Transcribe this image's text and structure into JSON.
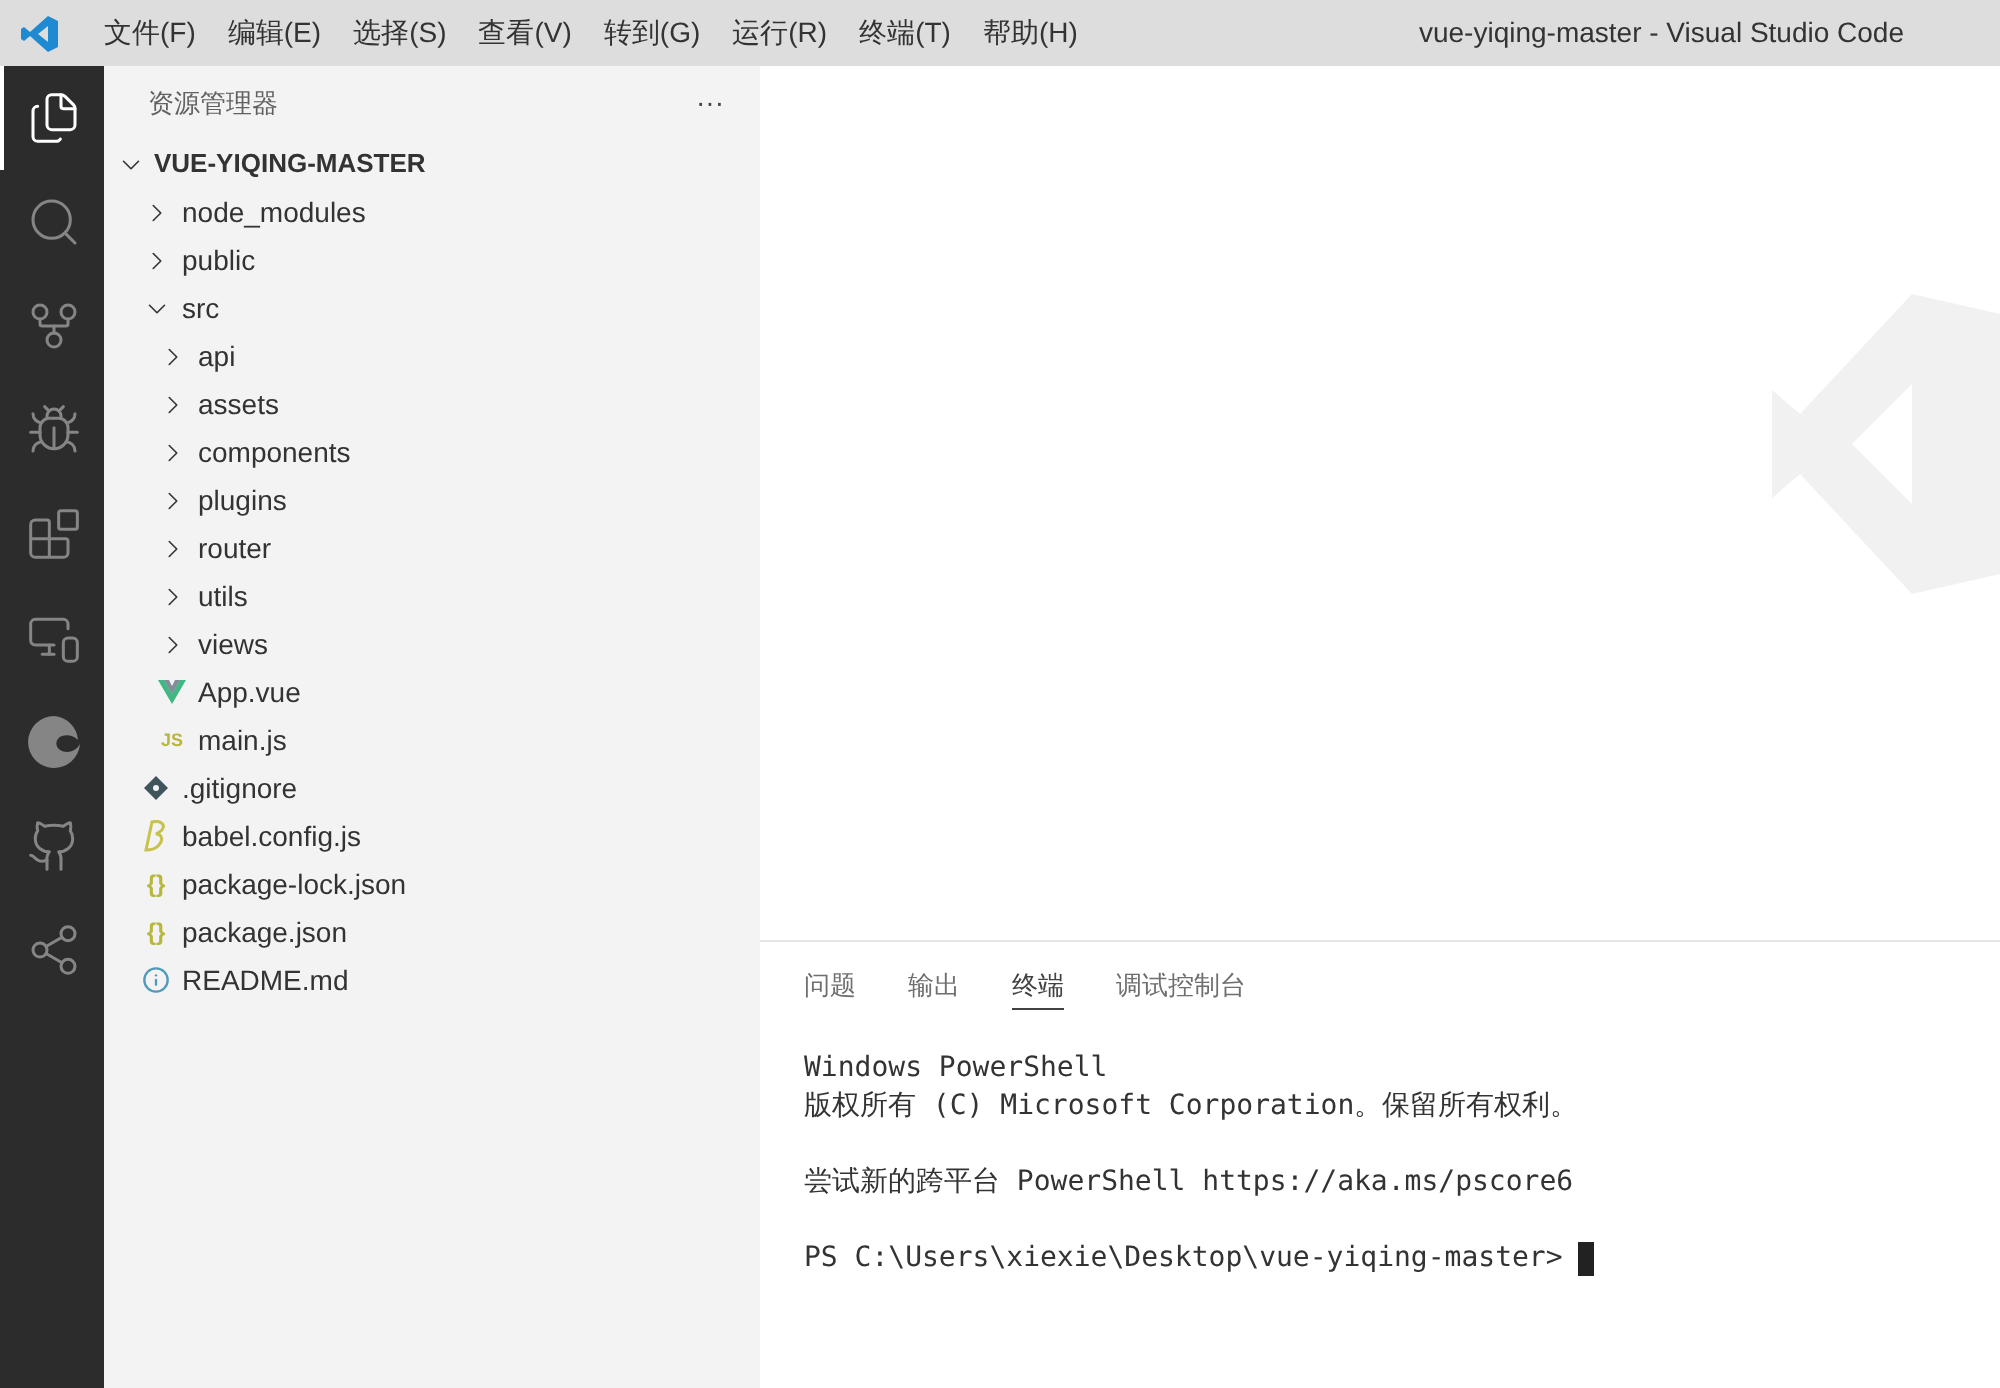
{
  "menu_bar": {
    "items": [
      "文件(F)",
      "编辑(E)",
      "选择(S)",
      "查看(V)",
      "转到(G)",
      "运行(R)",
      "终端(T)",
      "帮助(H)"
    ],
    "title": "vue-yiqing-master - Visual Studio Code"
  },
  "activity_bar": [
    {
      "kind": "explorer",
      "selected": true
    },
    {
      "kind": "search",
      "selected": false
    },
    {
      "kind": "source-control",
      "selected": false
    },
    {
      "kind": "run-debug",
      "selected": false
    },
    {
      "kind": "extensions",
      "selected": false
    },
    {
      "kind": "remote",
      "selected": false
    },
    {
      "kind": "browser",
      "selected": false
    },
    {
      "kind": "github",
      "selected": false
    },
    {
      "kind": "share",
      "selected": false
    }
  ],
  "explorer": {
    "title": "资源管理器",
    "more": "···",
    "root": {
      "label": "VUE-YIQING-MASTER",
      "expanded": true,
      "children": [
        {
          "label": "node_modules",
          "kind": "folder",
          "expanded": false
        },
        {
          "label": "public",
          "kind": "folder",
          "expanded": false
        },
        {
          "label": "src",
          "kind": "folder",
          "expanded": true,
          "children": [
            {
              "label": "api",
              "kind": "folder",
              "expanded": false
            },
            {
              "label": "assets",
              "kind": "folder",
              "expanded": false
            },
            {
              "label": "components",
              "kind": "folder",
              "expanded": false
            },
            {
              "label": "plugins",
              "kind": "folder",
              "expanded": false
            },
            {
              "label": "router",
              "kind": "folder",
              "expanded": false
            },
            {
              "label": "utils",
              "kind": "folder",
              "expanded": false
            },
            {
              "label": "views",
              "kind": "folder",
              "expanded": false
            },
            {
              "label": "App.vue",
              "kind": "vue"
            },
            {
              "label": "main.js",
              "kind": "js",
              "icon_text": "JS"
            }
          ]
        },
        {
          "label": ".gitignore",
          "kind": "git"
        },
        {
          "label": "babel.config.js",
          "kind": "babel"
        },
        {
          "label": "package-lock.json",
          "kind": "json",
          "icon_text": "{}"
        },
        {
          "label": "package.json",
          "kind": "json",
          "icon_text": "{}"
        },
        {
          "label": "README.md",
          "kind": "info"
        }
      ]
    }
  },
  "panel": {
    "tabs": [
      {
        "label": "问题",
        "selected": false
      },
      {
        "label": "输出",
        "selected": false
      },
      {
        "label": "终端",
        "selected": true
      },
      {
        "label": "调试控制台",
        "selected": false
      }
    ],
    "terminal": {
      "blocks": [
        [
          "Windows PowerShell",
          "版权所有 (C) Microsoft Corporation。保留所有权利。"
        ],
        [
          "尝试新的跨平台 PowerShell https://aka.ms/pscore6"
        ],
        [
          "PS C:\\Users\\xiexie\\Desktop\\vue-yiqing-master>"
        ]
      ],
      "cursor": true
    }
  }
}
